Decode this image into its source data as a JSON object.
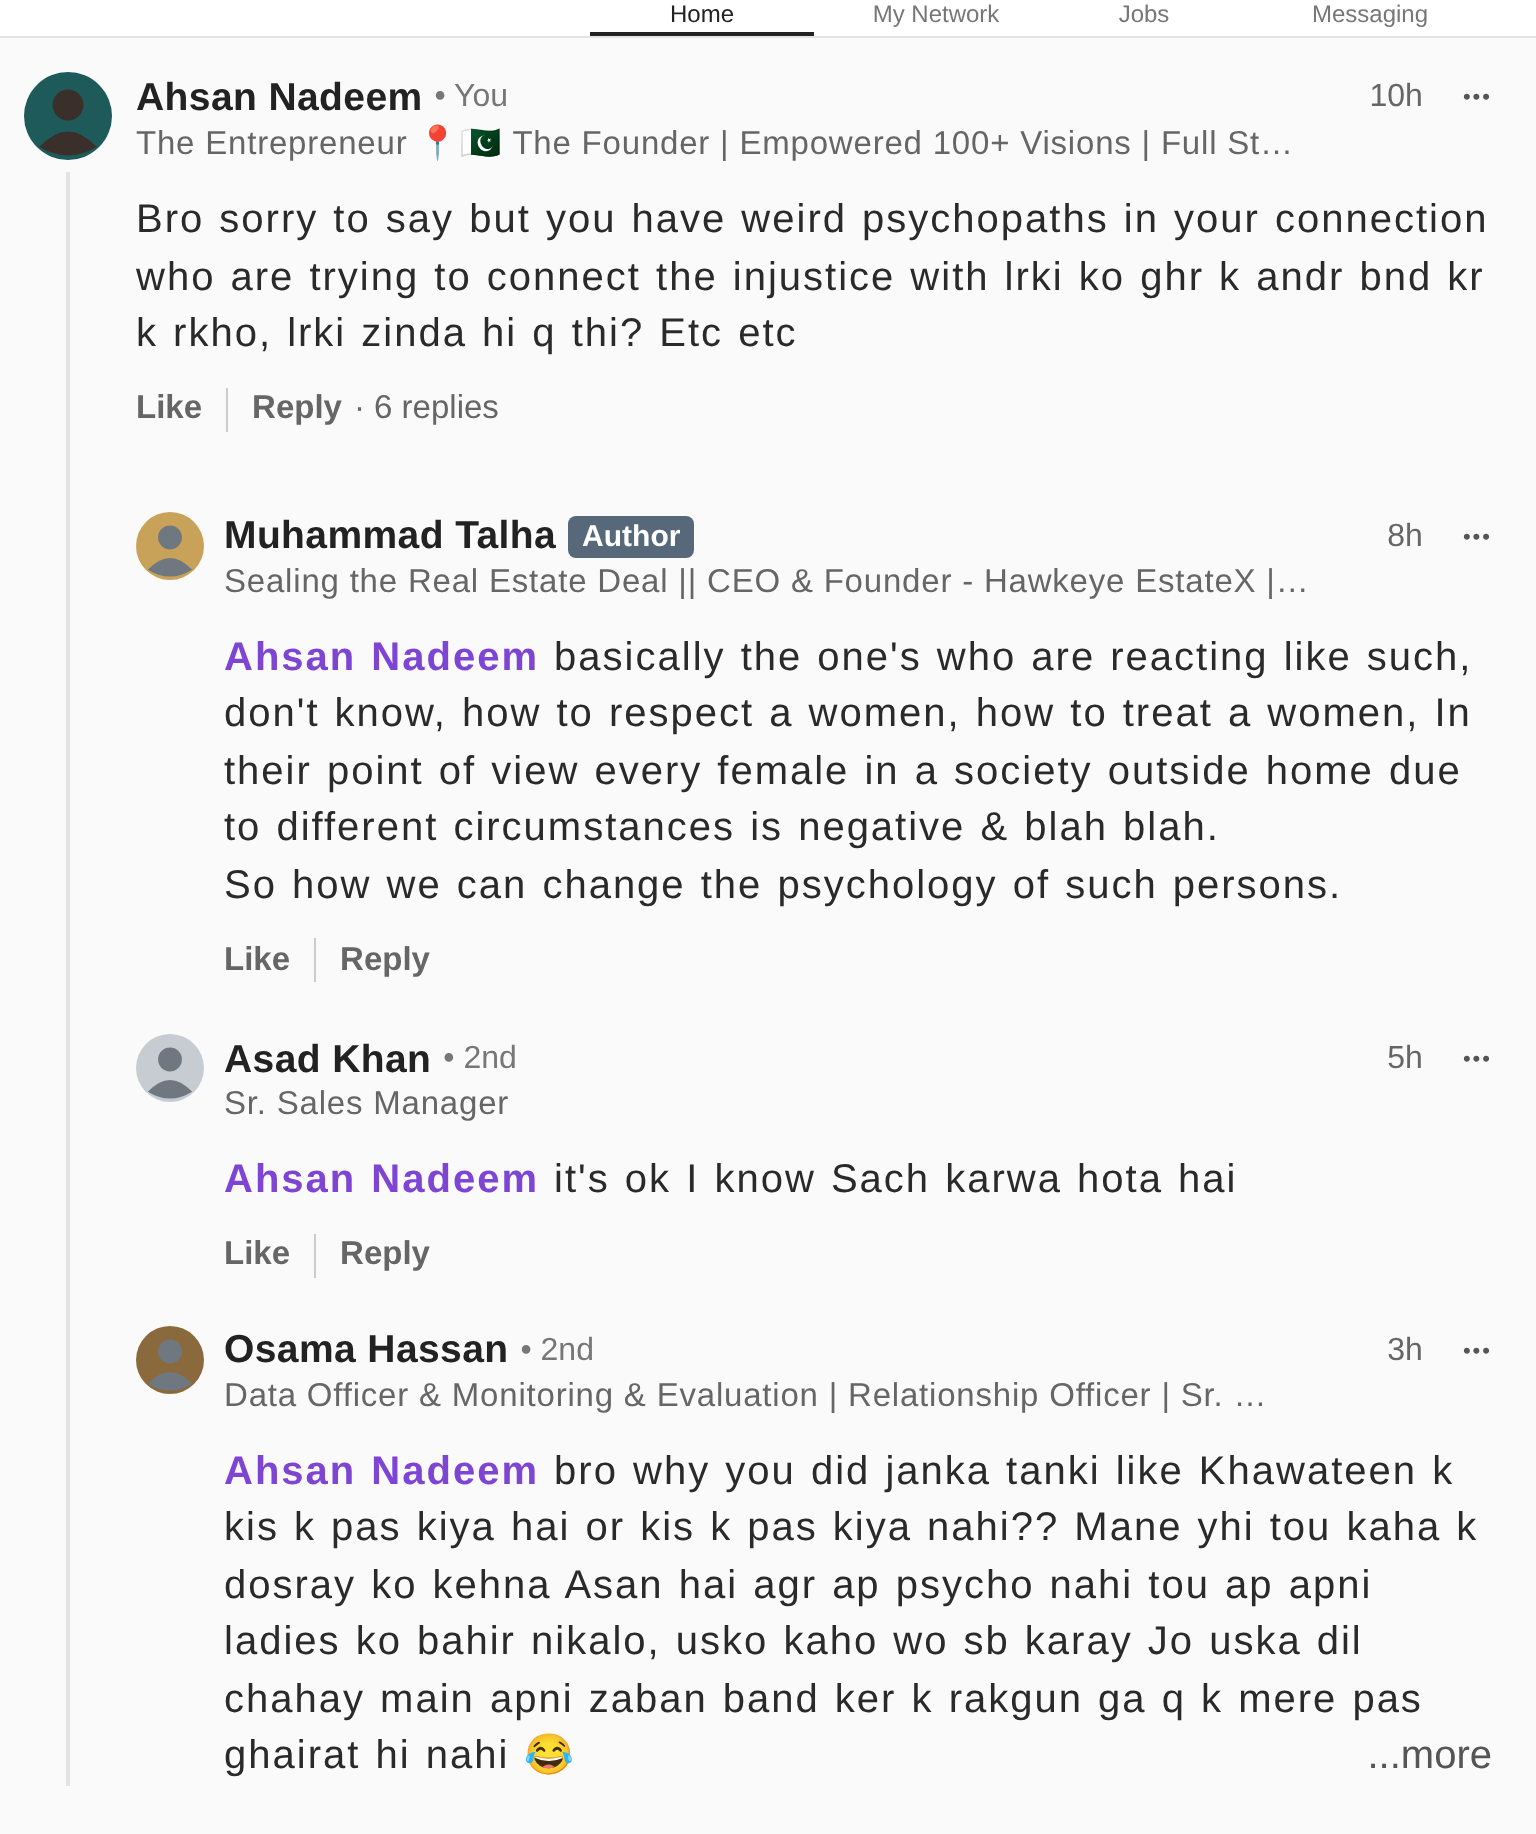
{
  "nav": {
    "tabs": [
      {
        "label": "Home",
        "selected": true
      },
      {
        "label": "My Network",
        "selected": false
      },
      {
        "label": "Jobs",
        "selected": false
      },
      {
        "label": "Messaging",
        "selected": false
      }
    ]
  },
  "comment": {
    "name": "Ahsan Nadeem",
    "degree": "• You",
    "headline": "The Entrepreneur 📍🇵🇰 The Founder | Empowered 100+ Visions | Full St…",
    "time": "10h",
    "more": "•••",
    "body": "Bro sorry to say but you have weird psychopaths in your connection who are trying to connect the injustice with lrki ko ghr k andr bnd kr k rkho, lrki zinda hi q thi? Etc etc",
    "like": "Like",
    "reply": "Reply",
    "replies_count": "· 6 replies",
    "replies": [
      {
        "name": "Muhammad Talha",
        "badge": "Author",
        "headline": "Sealing the Real Estate Deal || CEO & Founder - Hawkeye EstateX |…",
        "time": "8h",
        "more": "•••",
        "mention": "Ahsan Nadeem",
        "body": " basically the one's who are reacting like such, don't know, how to respect a women, how to treat a women, In their point of view every female in a society outside home due to different circumstances is negative & blah blah.\nSo how we can change the psychology of such persons.",
        "like": "Like",
        "reply": "Reply"
      },
      {
        "name": "Asad Khan",
        "degree": "• 2nd",
        "headline": "Sr. Sales Manager",
        "time": "5h",
        "more": "•••",
        "mention": "Ahsan Nadeem",
        "body": " it's ok I know Sach karwa hota hai",
        "like": "Like",
        "reply": "Reply"
      },
      {
        "name": "Osama Hassan",
        "degree": "• 2nd",
        "headline": "Data Officer & Monitoring & Evaluation | Relationship Officer | Sr. …",
        "time": "3h",
        "more": "•••",
        "mention": "Ahsan Nadeem",
        "body": " bro why you did janka tanki like Khawateen k kis k pas kiya hai or kis k pas kiya nahi?? Mane yhi tou kaha k dosray ko kehna Asan hai agr ap psycho nahi tou ap apni ladies ko bahir nikalo, usko kaho wo sb karay Jo uska dil chahay main apni zaban band ker k rakgun ga q k mere pas ghairat hi nahi 😂",
        "see_more": "...more"
      }
    ]
  }
}
